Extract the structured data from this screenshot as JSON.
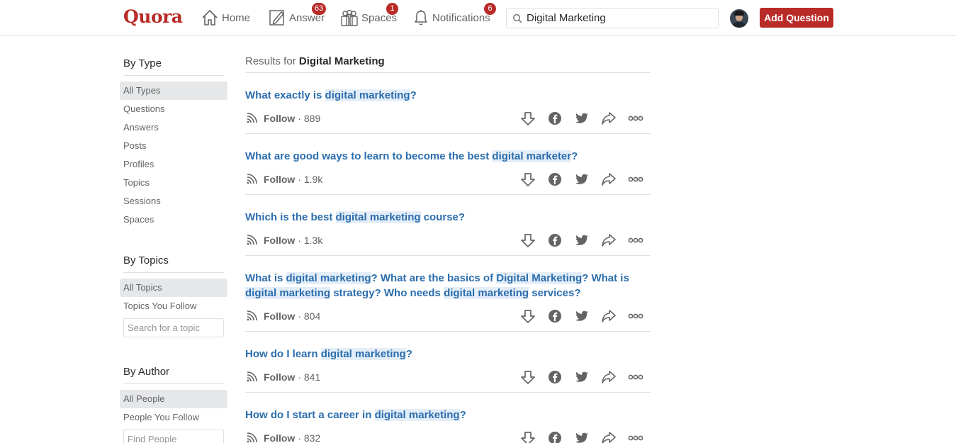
{
  "header": {
    "logo": "Quora",
    "nav": [
      {
        "label": "Home",
        "badge": ""
      },
      {
        "label": "Answer",
        "badge": "63"
      },
      {
        "label": "Spaces",
        "badge": "1"
      },
      {
        "label": "Notifications",
        "badge": "6"
      }
    ],
    "search_value": "Digital Marketing",
    "add_question_label": "Add Question",
    "brand_color": "#b92b27"
  },
  "sidebar": {
    "by_type": {
      "title": "By Type",
      "items": [
        "All Types",
        "Questions",
        "Answers",
        "Posts",
        "Profiles",
        "Topics",
        "Sessions",
        "Spaces"
      ]
    },
    "by_topics": {
      "title": "By Topics",
      "items": [
        "All Topics",
        "Topics You Follow"
      ],
      "search_placeholder": "Search for a topic"
    },
    "by_author": {
      "title": "By Author",
      "items": [
        "All People",
        "People You Follow"
      ],
      "search_placeholder": "Find People"
    }
  },
  "results": {
    "prefix": "Results for",
    "query": "Digital Marketing",
    "follow_label": "Follow",
    "items": [
      {
        "title": [
          [
            "What exactly is ",
            false
          ],
          [
            "digital marketing",
            true
          ],
          [
            "?",
            false
          ]
        ],
        "count": "889"
      },
      {
        "title": [
          [
            "What are good ways to learn to become the best ",
            false
          ],
          [
            "digital marketer",
            true
          ],
          [
            "?",
            false
          ]
        ],
        "count": "1.9k"
      },
      {
        "title": [
          [
            "Which is the best ",
            false
          ],
          [
            "digital marketing",
            true
          ],
          [
            " course?",
            false
          ]
        ],
        "count": "1.3k"
      },
      {
        "title": [
          [
            "What is ",
            false
          ],
          [
            "digital marketing",
            true
          ],
          [
            "? What are the basics of ",
            false
          ],
          [
            "Digital Marketing",
            true
          ],
          [
            "? What is ",
            false
          ],
          [
            "digital marketing",
            true
          ],
          [
            " strategy? Who needs ",
            false
          ],
          [
            "digital marketing",
            true
          ],
          [
            " services?",
            false
          ]
        ],
        "count": "804"
      },
      {
        "title": [
          [
            "How do I learn ",
            false
          ],
          [
            "digital marketing",
            true
          ],
          [
            "?",
            false
          ]
        ],
        "count": "841"
      },
      {
        "title": [
          [
            "How do I start a career in ",
            false
          ],
          [
            "digital marketing",
            true
          ],
          [
            "?",
            false
          ]
        ],
        "count": "832"
      }
    ],
    "actions": [
      "downvote-icon",
      "facebook-icon",
      "twitter-icon",
      "share-icon",
      "more-icon"
    ]
  }
}
